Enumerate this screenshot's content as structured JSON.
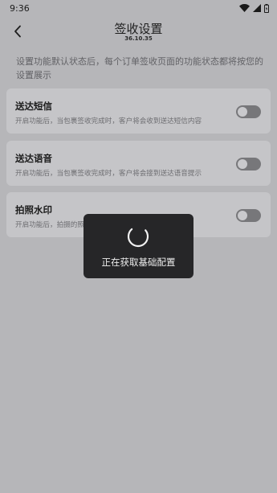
{
  "status_bar": {
    "time": "9:36"
  },
  "header": {
    "title": "签收设置",
    "version": "36.10.35"
  },
  "description": "设置功能默认状态后，每个订单签收页面的功能状态都将按您的设置展示",
  "settings": [
    {
      "title": "送达短信",
      "desc": "开启功能后，当包裹签收完成时，客户将会收到送达短信内容",
      "enabled": false
    },
    {
      "title": "送达语音",
      "desc": "开启功能后，当包裹签收完成时，客户将会接到送达语音提示",
      "enabled": false
    },
    {
      "title": "拍照水印",
      "desc": "开启功能后，拍摄的照片上将显示拍照时间、地址等信息",
      "enabled": false
    }
  ],
  "toast": {
    "message": "正在获取基础配置"
  },
  "colors": {
    "background": "#b6b6b9",
    "card": "#c5c5c8",
    "toggle_off": "#77777a",
    "toast": "#262628"
  },
  "icons": {
    "back": "chevron-left-icon",
    "wifi": "wifi-icon",
    "signal": "signal-icon",
    "battery": "battery-icon",
    "loading": "spinner-icon"
  }
}
